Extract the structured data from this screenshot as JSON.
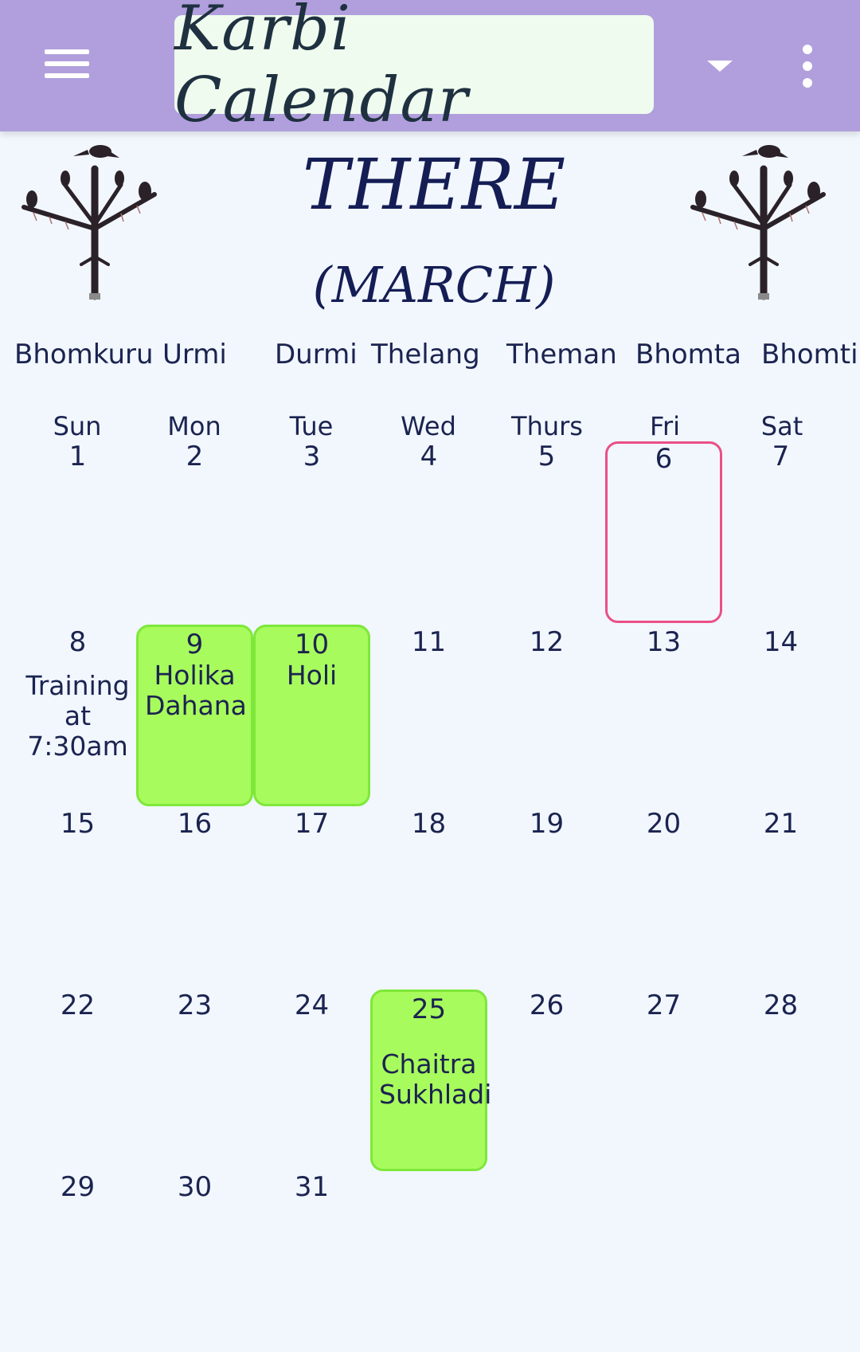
{
  "app": {
    "title": "Karbi Calendar"
  },
  "header": {
    "month_karbi": "THERE",
    "month_english": "(MARCH)"
  },
  "karbi_days": [
    "Bhomkuru",
    "Urmi",
    "Durmi",
    "Thelang",
    "Theman",
    "Bhomta",
    "Bhomti"
  ],
  "weekdays": [
    "Sun",
    "Mon",
    "Tue",
    "Wed",
    "Thurs",
    "Fri",
    "Sat"
  ],
  "colors": {
    "appbar": "#b09fdc",
    "holiday": "#a8fb5c",
    "today_outline": "#ea4f86"
  },
  "days": [
    {
      "day": "1"
    },
    {
      "day": "2"
    },
    {
      "day": "3"
    },
    {
      "day": "4"
    },
    {
      "day": "5"
    },
    {
      "day": "6",
      "today": true
    },
    {
      "day": "7"
    },
    {
      "day": "8",
      "event": "Training at 7:30am"
    },
    {
      "day": "9",
      "event": "Holika Dahana",
      "holiday": true
    },
    {
      "day": "10",
      "event": "Holi",
      "holiday": true
    },
    {
      "day": "11"
    },
    {
      "day": "12"
    },
    {
      "day": "13"
    },
    {
      "day": "14"
    },
    {
      "day": "15"
    },
    {
      "day": "16"
    },
    {
      "day": "17"
    },
    {
      "day": "18"
    },
    {
      "day": "19"
    },
    {
      "day": "20"
    },
    {
      "day": "21"
    },
    {
      "day": "22"
    },
    {
      "day": "23"
    },
    {
      "day": "24"
    },
    {
      "day": "25",
      "event": "Chaitra Sukhladi",
      "holiday": true
    },
    {
      "day": "26"
    },
    {
      "day": "27"
    },
    {
      "day": "28"
    },
    {
      "day": "29"
    },
    {
      "day": "30"
    },
    {
      "day": "31"
    }
  ]
}
